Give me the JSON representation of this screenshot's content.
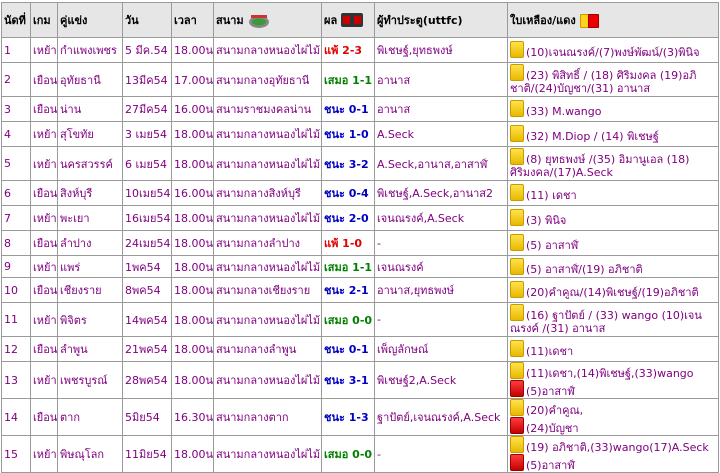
{
  "headers": {
    "no": "นัดที่",
    "game": "เกม",
    "opponent": "คู่แข่ง",
    "date": "วัน",
    "time": "เวลา",
    "stadium": "สนาม",
    "result": "ผล",
    "scorers": "ผู้ทำประตู(uttfc)",
    "cards": "ใบเหลือง/แดง"
  },
  "rows": [
    {
      "no": "1",
      "game": "เหย้า",
      "opponent": "กำแพงเพชร",
      "date": "5 มีค.54",
      "time": "18.00น.",
      "stadium": "สนามกลางหนองไผ่ไม้",
      "result": "แพ้ 2-3",
      "result_type": "loss",
      "scorers": "พิเชษฐ์,ยุทธพงษ์",
      "cards": [
        {
          "color": "yellow",
          "text": "(10)เจนณรงค์/(7)พงษ์พัฒน์/(3)พินิจ"
        }
      ]
    },
    {
      "no": "2",
      "game": "เยือน",
      "opponent": "อุทัยธานี",
      "date": "13มีค54",
      "time": "17.00น.",
      "stadium": "สนามกลางอุทัยธานี",
      "result": "เสมอ 1-1",
      "result_type": "draw",
      "scorers": "อานาส",
      "cards": [
        {
          "color": "yellow",
          "text": "(23) พิสิทธิ์ / (18) ศิริมงคล (19)อภิชาติ/(24)บัญชา/(31) อานาส"
        }
      ]
    },
    {
      "no": "3",
      "game": "เยือน",
      "opponent": "น่าน",
      "date": "27มีค54",
      "time": "16.00น.",
      "stadium": "สนามราชมงคลน่าน",
      "result": "ชนะ 0-1",
      "result_type": "win",
      "scorers": "อานาส",
      "cards": [
        {
          "color": "yellow",
          "text": "(33) M.wango"
        }
      ]
    },
    {
      "no": "4",
      "game": "เหย้า",
      "opponent": "สุโขทัย",
      "date": "3 เมย54",
      "time": "18.00น.",
      "stadium": "สนามกลางหนองไผ่ไม้",
      "result": "ชนะ 1-0",
      "result_type": "win",
      "scorers": "A.Seck",
      "cards": [
        {
          "color": "yellow",
          "text": "(32) M.Diop / (14) พิเชษฐ์"
        }
      ]
    },
    {
      "no": "5",
      "game": "เหย้า",
      "opponent": "นครสวรรค์",
      "date": "6 เมย54",
      "time": "18.00น.",
      "stadium": "สนามกลางหนองไผ่ไม้",
      "result": "ชนะ 3-2",
      "result_type": "win",
      "scorers": "A.Seck,อานาส,อาสาฬ์",
      "cards": [
        {
          "color": "yellow",
          "text": "(8) ยุทธพงษ์ /(35) อิมานูเอล (18) ศิริมงคล/(17)A.Seck"
        }
      ]
    },
    {
      "no": "6",
      "game": "เยือน",
      "opponent": "สิงห์บุรี",
      "date": "10เมย54",
      "time": "16.00น.",
      "stadium": "สนามกลางสิงห์บุรี",
      "result": "ชนะ 0-4",
      "result_type": "win",
      "scorers": "พิเชษฐ์,A.Seck,อานาส2",
      "cards": [
        {
          "color": "yellow",
          "text": "(11) เดชา"
        }
      ]
    },
    {
      "no": "7",
      "game": "เหย้า",
      "opponent": "พะเยา",
      "date": "16เมย54",
      "time": "18.00น.",
      "stadium": "สนามกลางหนองไผ่ไม้",
      "result": "ชนะ 2-0",
      "result_type": "win",
      "scorers": "เจนณรงค์,A.Seck",
      "cards": [
        {
          "color": "yellow",
          "text": "(3) พินิจ"
        }
      ]
    },
    {
      "no": "8",
      "game": "เยือน",
      "opponent": "ลำปาง",
      "date": "24เมย54",
      "time": "18.00น.",
      "stadium": "สนามกลางลำปาง",
      "result": "แพ้ 1-0",
      "result_type": "loss",
      "scorers": "-",
      "cards": [
        {
          "color": "yellow",
          "text": "(5) อาสาฬ์"
        }
      ]
    },
    {
      "no": "9",
      "game": "เหย้า",
      "opponent": "แพร่",
      "date": "1พค54",
      "time": "18.00น.",
      "stadium": "สนามกลางหนองไผ่ไม้",
      "result": "เสมอ 1-1",
      "result_type": "draw",
      "scorers": "เจนณรงค์",
      "cards": [
        {
          "color": "yellow",
          "text": "(5) อาสาฬ์/(19) อภิชาติ"
        }
      ]
    },
    {
      "no": "10",
      "game": "เยือน",
      "opponent": "เชียงราย",
      "date": "8พค54",
      "time": "18.00น.",
      "stadium": "สนามกลางเชียงราย",
      "result": "ชนะ 2-1",
      "result_type": "win",
      "scorers": "อานาส,ยุทธพงษ์",
      "cards": [
        {
          "color": "yellow",
          "text": "(20)คำคูณ/(14)พิเชษฐ์/(19)อภิชาติ"
        }
      ]
    },
    {
      "no": "11",
      "game": "เหย้า",
      "opponent": "พิจิตร",
      "date": "14พค54",
      "time": "18.00น.",
      "stadium": "สนามกลางหนองไผ่ไม้",
      "result": "เสมอ 0-0",
      "result_type": "draw",
      "scorers": "-",
      "cards": [
        {
          "color": "yellow",
          "text": "(16) ฐาปัตย์ / (33) wango (10)เจนณรงค์ /(31) อานาส"
        }
      ]
    },
    {
      "no": "12",
      "game": "เยือน",
      "opponent": "ลำพูน",
      "date": "21พค54",
      "time": "18.00น.",
      "stadium": "สนามกลางลำพูน",
      "result": "ชนะ 0-1",
      "result_type": "win",
      "scorers": "เพ็ญลักษณ์",
      "cards": [
        {
          "color": "yellow",
          "text": "(11)เดชา"
        }
      ]
    },
    {
      "no": "13",
      "game": "เหย้า",
      "opponent": "เพชรบูรณ์",
      "date": "28พค54",
      "time": "18.00น.",
      "stadium": "สนามกลางหนองไผ่ไม้",
      "result": "ชนะ 3-1",
      "result_type": "win",
      "scorers": "พิเชษฐ์2,A.Seck",
      "cards": [
        {
          "color": "yellow",
          "text": "(11)เดชา,(14)พิเชษฐ์,(33)wango"
        },
        {
          "color": "red",
          "text": "(5)อาสาฬ์"
        }
      ]
    },
    {
      "no": "14",
      "game": "เยือน",
      "opponent": "ตาก",
      "date": "5มิย54",
      "time": "16.30น.",
      "stadium": "สนามกลางตาก",
      "result": "ชนะ 1-3",
      "result_type": "win",
      "scorers": "ฐาปัตย์,เจนณรงค์,A.Seck",
      "cards": [
        {
          "color": "yellow",
          "text": "(20)คำคูณ,"
        },
        {
          "color": "red",
          "text": "(24)บัญชา"
        }
      ]
    },
    {
      "no": "15",
      "game": "เหย้า",
      "opponent": "พิษณุโลก",
      "date": "11มิย54",
      "time": "18.00น.",
      "stadium": "สนามกลางหนองไผ่ไม้",
      "result": "เสมอ 0-0",
      "result_type": "draw",
      "scorers": "-",
      "cards": [
        {
          "color": "yellow",
          "text": "(19) อภิชาติ,(33)wango(17)A.Seck"
        },
        {
          "color": "red",
          "text": "(5)อาสาฬ์"
        }
      ]
    }
  ],
  "colors": {
    "loss": "#e00000",
    "draw": "#008000",
    "win": "#0000c0",
    "text": "#800080"
  },
  "icons": {
    "stadium": "stadium-icon",
    "result": "scoreboard-icon",
    "cards": "yellow-red-card-icon"
  }
}
